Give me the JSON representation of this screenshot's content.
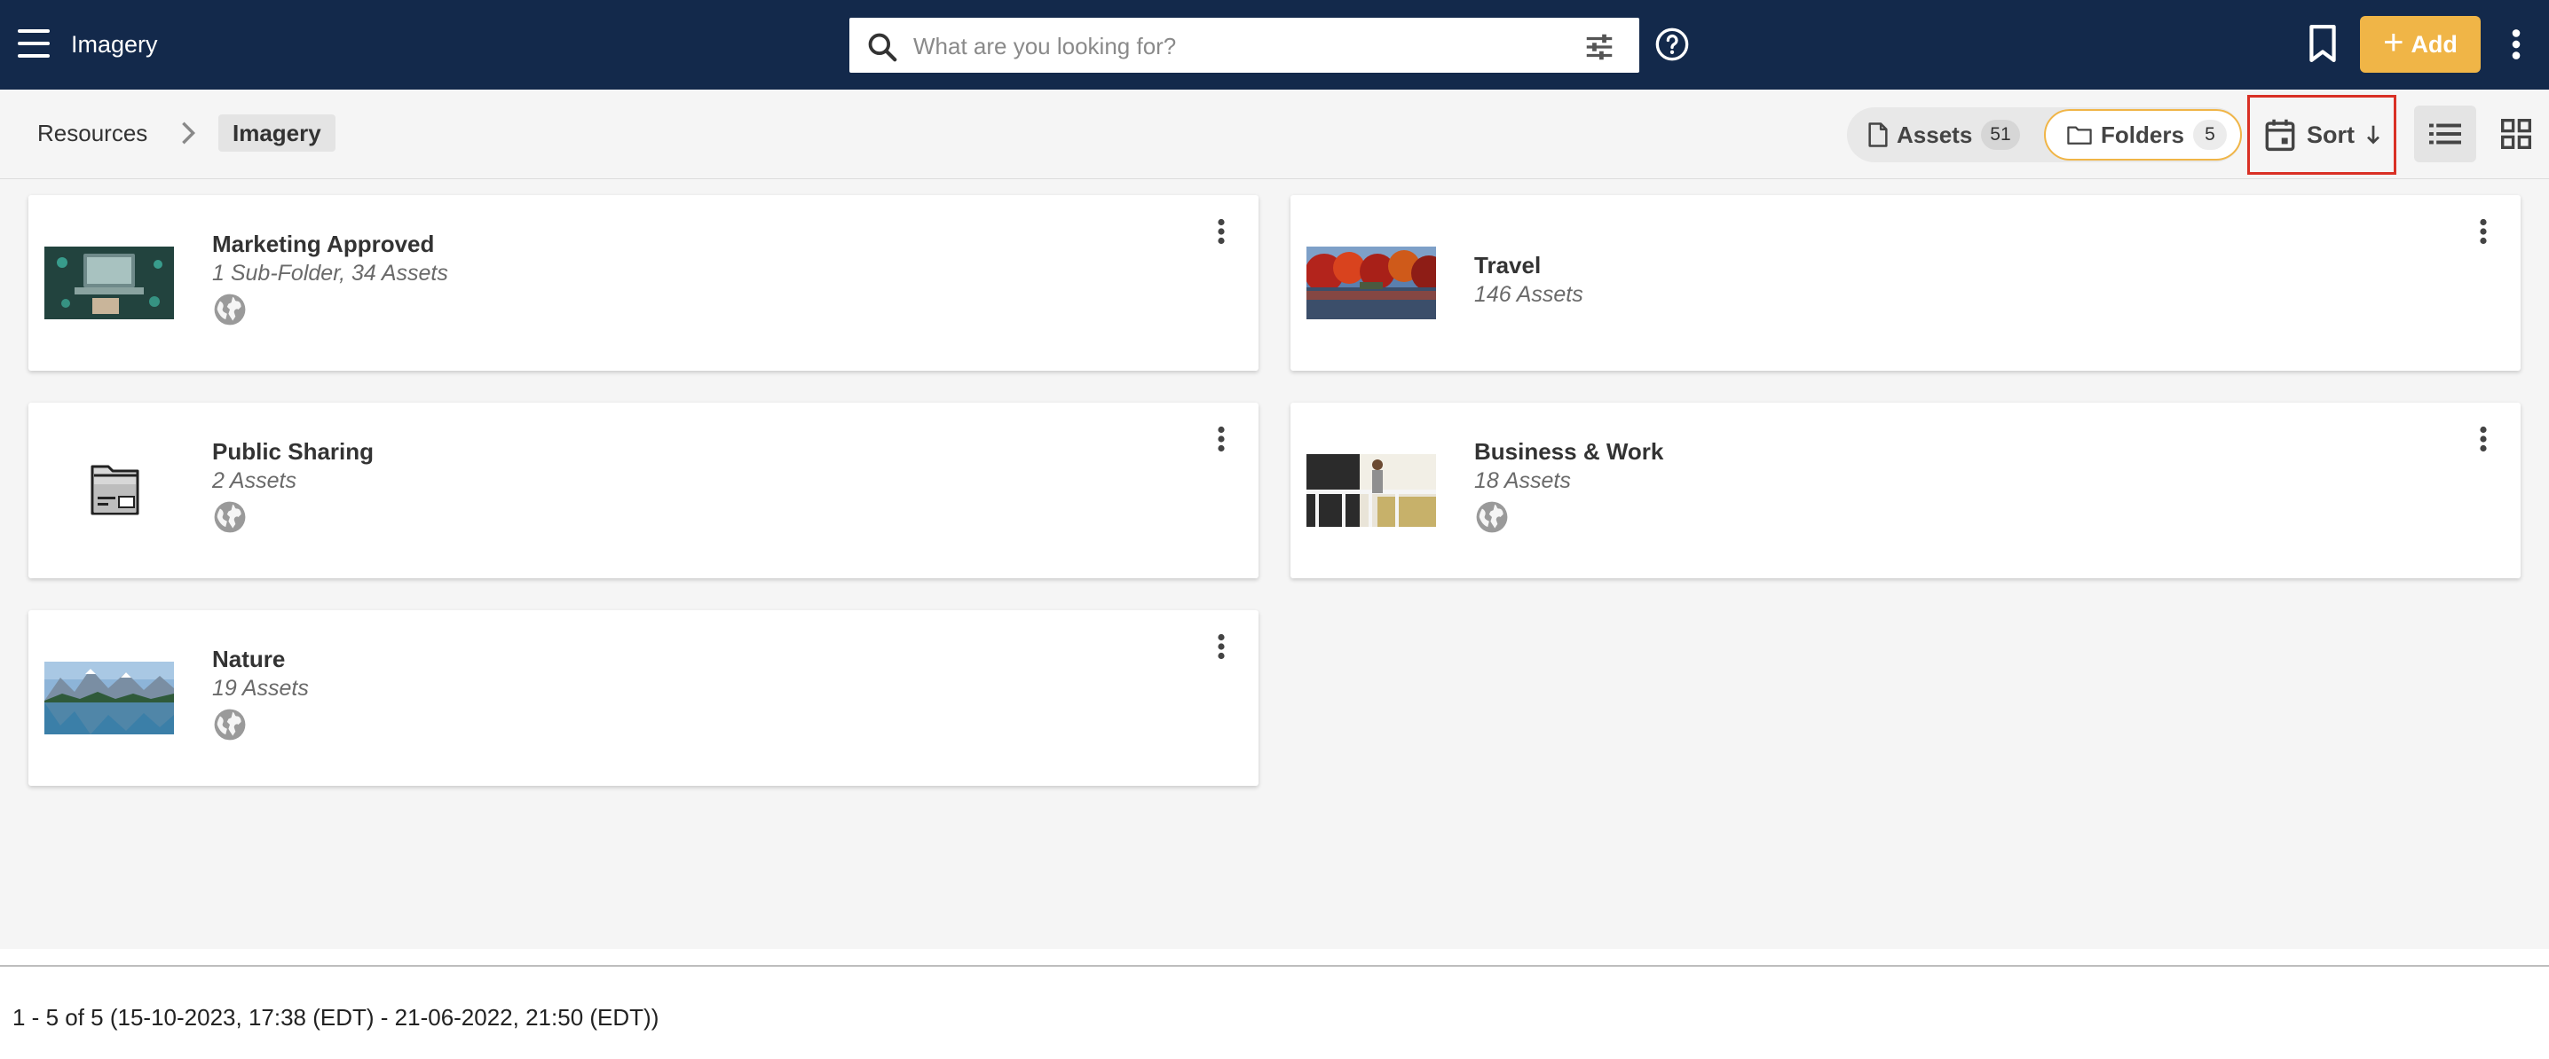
{
  "header": {
    "title": "Imagery",
    "search_placeholder": "What are you looking for?",
    "add_label": "Add"
  },
  "breadcrumb": {
    "root": "Resources",
    "current": "Imagery"
  },
  "toolbar": {
    "assets_label": "Assets",
    "assets_count": "51",
    "folders_label": "Folders",
    "folders_count": "5",
    "sort_label": "Sort"
  },
  "folders": [
    {
      "name": "Marketing Approved",
      "meta": "1 Sub-Folder, 34 Assets",
      "public": true
    },
    {
      "name": "Travel",
      "meta": "146 Assets",
      "public": false
    },
    {
      "name": "Public Sharing",
      "meta": "2 Assets",
      "public": true
    },
    {
      "name": "Business & Work",
      "meta": "18 Assets",
      "public": true
    },
    {
      "name": "Nature",
      "meta": "19 Assets",
      "public": true
    }
  ],
  "footer": {
    "range_text": "1 - 5 of 5 (15-10-2023, 17:38 (EDT) - 21-06-2022, 21:50 (EDT))"
  },
  "colors": {
    "topbar": "#13294b",
    "accent": "#f0b547",
    "highlight": "#d93025"
  }
}
